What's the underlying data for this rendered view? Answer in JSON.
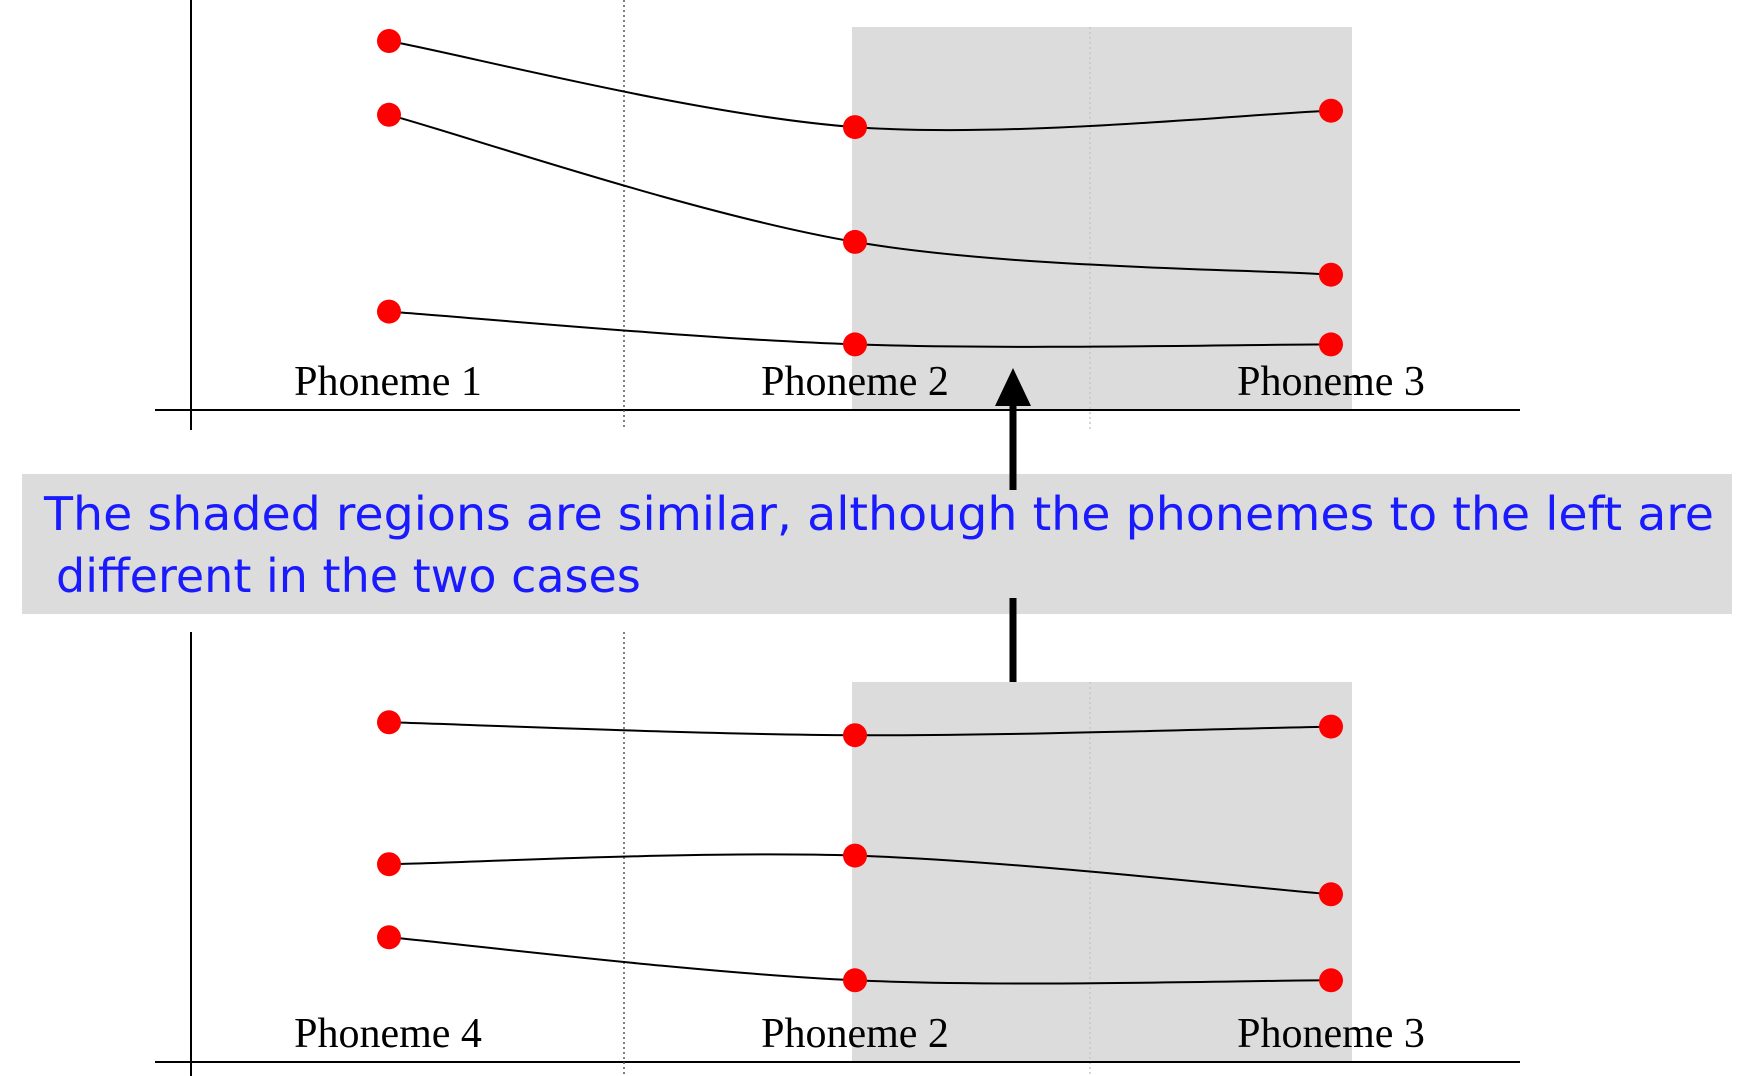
{
  "colors": {
    "dot": "#ff0000",
    "shade": "#dcdcdc",
    "caption_band": "#dcdcdc",
    "caption_text": "#1a1aff",
    "line": "#000000"
  },
  "caption": {
    "line1": "The shaded regions are similar, although the phonemes to the left are",
    "line2": "different in the two cases"
  },
  "panels": [
    {
      "labels": [
        "Phoneme 1",
        "Phoneme 2",
        "Phoneme 3"
      ],
      "traces": [
        {
          "values": [
            0.9,
            0.69,
            0.73
          ]
        },
        {
          "values": [
            0.72,
            0.41,
            0.33
          ]
        },
        {
          "values": [
            0.24,
            0.16,
            0.16
          ]
        }
      ]
    },
    {
      "labels": [
        "Phoneme 4",
        "Phoneme 2",
        "Phoneme 3"
      ],
      "traces": [
        {
          "values": [
            0.79,
            0.76,
            0.78
          ]
        },
        {
          "values": [
            0.46,
            0.48,
            0.39
          ]
        },
        {
          "values": [
            0.29,
            0.19,
            0.19
          ]
        }
      ]
    }
  ]
}
